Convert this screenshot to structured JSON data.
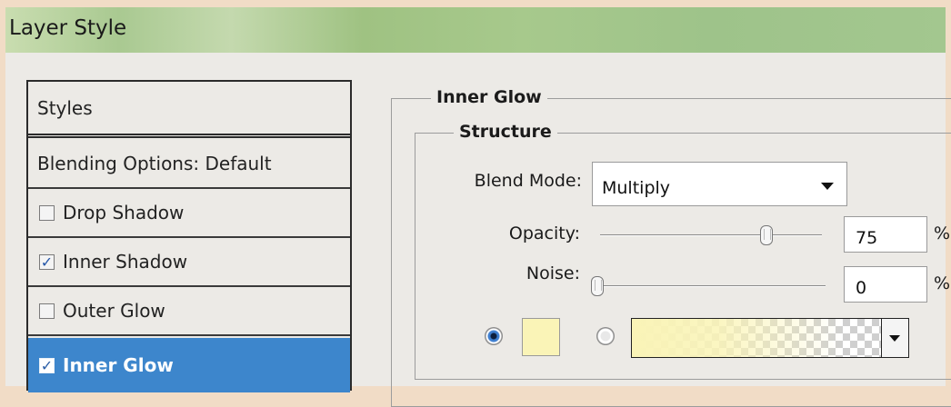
{
  "window": {
    "title": "Layer Style"
  },
  "styles_list": {
    "header": "Styles",
    "blending": "Blending Options: Default",
    "items": [
      {
        "label": "Drop Shadow",
        "checked": false,
        "selected": false
      },
      {
        "label": "Inner Shadow",
        "checked": true,
        "selected": false
      },
      {
        "label": "Outer Glow",
        "checked": false,
        "selected": false
      },
      {
        "label": "Inner Glow",
        "checked": true,
        "selected": true
      }
    ]
  },
  "panel": {
    "section_title": "Inner Glow",
    "group_title": "Structure",
    "blend_mode": {
      "label": "Blend Mode:",
      "value": "Multiply"
    },
    "opacity": {
      "label": "Opacity:",
      "value": "75",
      "unit": "%"
    },
    "noise": {
      "label": "Noise:",
      "value": "0",
      "unit": "%"
    },
    "glow_color": "#faf4b7",
    "selected_source": "color"
  },
  "colors": {
    "selection": "#3d86cc",
    "title_bar": "#a9c991"
  }
}
